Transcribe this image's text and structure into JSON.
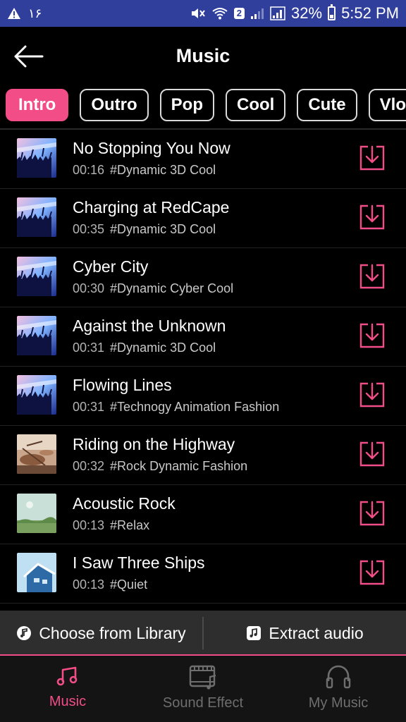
{
  "status_bar": {
    "left_number": "۱۶",
    "sim_badge": "2",
    "battery_percent_text": "32%",
    "battery_level": 0.32,
    "time": "5:52 PM"
  },
  "header": {
    "title": "Music",
    "back_icon": "arrow-left-icon"
  },
  "tabs": [
    {
      "label": "Intro",
      "active": true
    },
    {
      "label": "Outro",
      "active": false
    },
    {
      "label": "Pop",
      "active": false
    },
    {
      "label": "Cool",
      "active": false
    },
    {
      "label": "Cute",
      "active": false
    },
    {
      "label": "Vlog",
      "active": false
    }
  ],
  "tracks": [
    {
      "title": "No Stopping You Now",
      "duration": "00:16",
      "tags": "#Dynamic 3D Cool",
      "thumb": "concert"
    },
    {
      "title": "Charging at RedCape",
      "duration": "00:35",
      "tags": "#Dynamic 3D Cool",
      "thumb": "concert"
    },
    {
      "title": "Cyber City",
      "duration": "00:30",
      "tags": "#Dynamic Cyber Cool",
      "thumb": "concert"
    },
    {
      "title": "Against the Unknown",
      "duration": "00:31",
      "tags": "#Dynamic 3D Cool",
      "thumb": "concert"
    },
    {
      "title": "Flowing Lines",
      "duration": "00:31",
      "tags": "#Technogy Animation Fashion",
      "thumb": "concert"
    },
    {
      "title": "Riding on the Highway",
      "duration": "00:32",
      "tags": "#Rock Dynamic Fashion",
      "thumb": "drums"
    },
    {
      "title": "Acoustic Rock",
      "duration": "00:13",
      "tags": "#Relax",
      "thumb": "field"
    },
    {
      "title": "I Saw Three Ships",
      "duration": "00:13",
      "tags": "#Quiet",
      "thumb": "house"
    }
  ],
  "actions": {
    "library_label": "Choose from Library",
    "extract_label": "Extract audio"
  },
  "nav": [
    {
      "label": "Music",
      "icon": "music-note-icon",
      "active": true
    },
    {
      "label": "Sound Effect",
      "icon": "film-music-icon",
      "active": false
    },
    {
      "label": "My Music",
      "icon": "headphones-icon",
      "active": false
    }
  ],
  "colors": {
    "accent": "#f24d87",
    "status_bar": "#2f3f9b",
    "background": "#000000"
  }
}
